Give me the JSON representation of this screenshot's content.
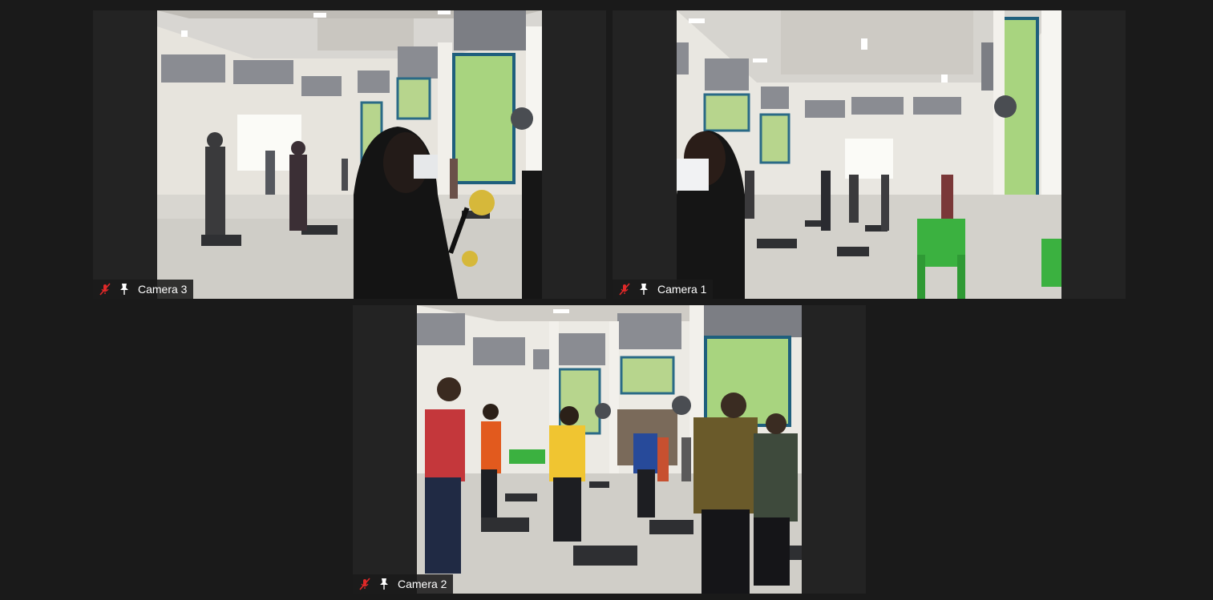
{
  "tiles": [
    {
      "id": "tile-1",
      "name": "Camera 3",
      "muted": true,
      "pinned": true
    },
    {
      "id": "tile-2",
      "name": "Camera 1",
      "muted": true,
      "pinned": true
    },
    {
      "id": "tile-3",
      "name": "Camera 2",
      "muted": true,
      "pinned": true
    }
  ],
  "colors": {
    "background": "#1a1a1a",
    "tile_background": "#232323",
    "muted_icon": "#e02828",
    "label_text": "#ffffff"
  },
  "icons": {
    "muted": "microphone-muted-icon",
    "pin": "pin-icon"
  }
}
